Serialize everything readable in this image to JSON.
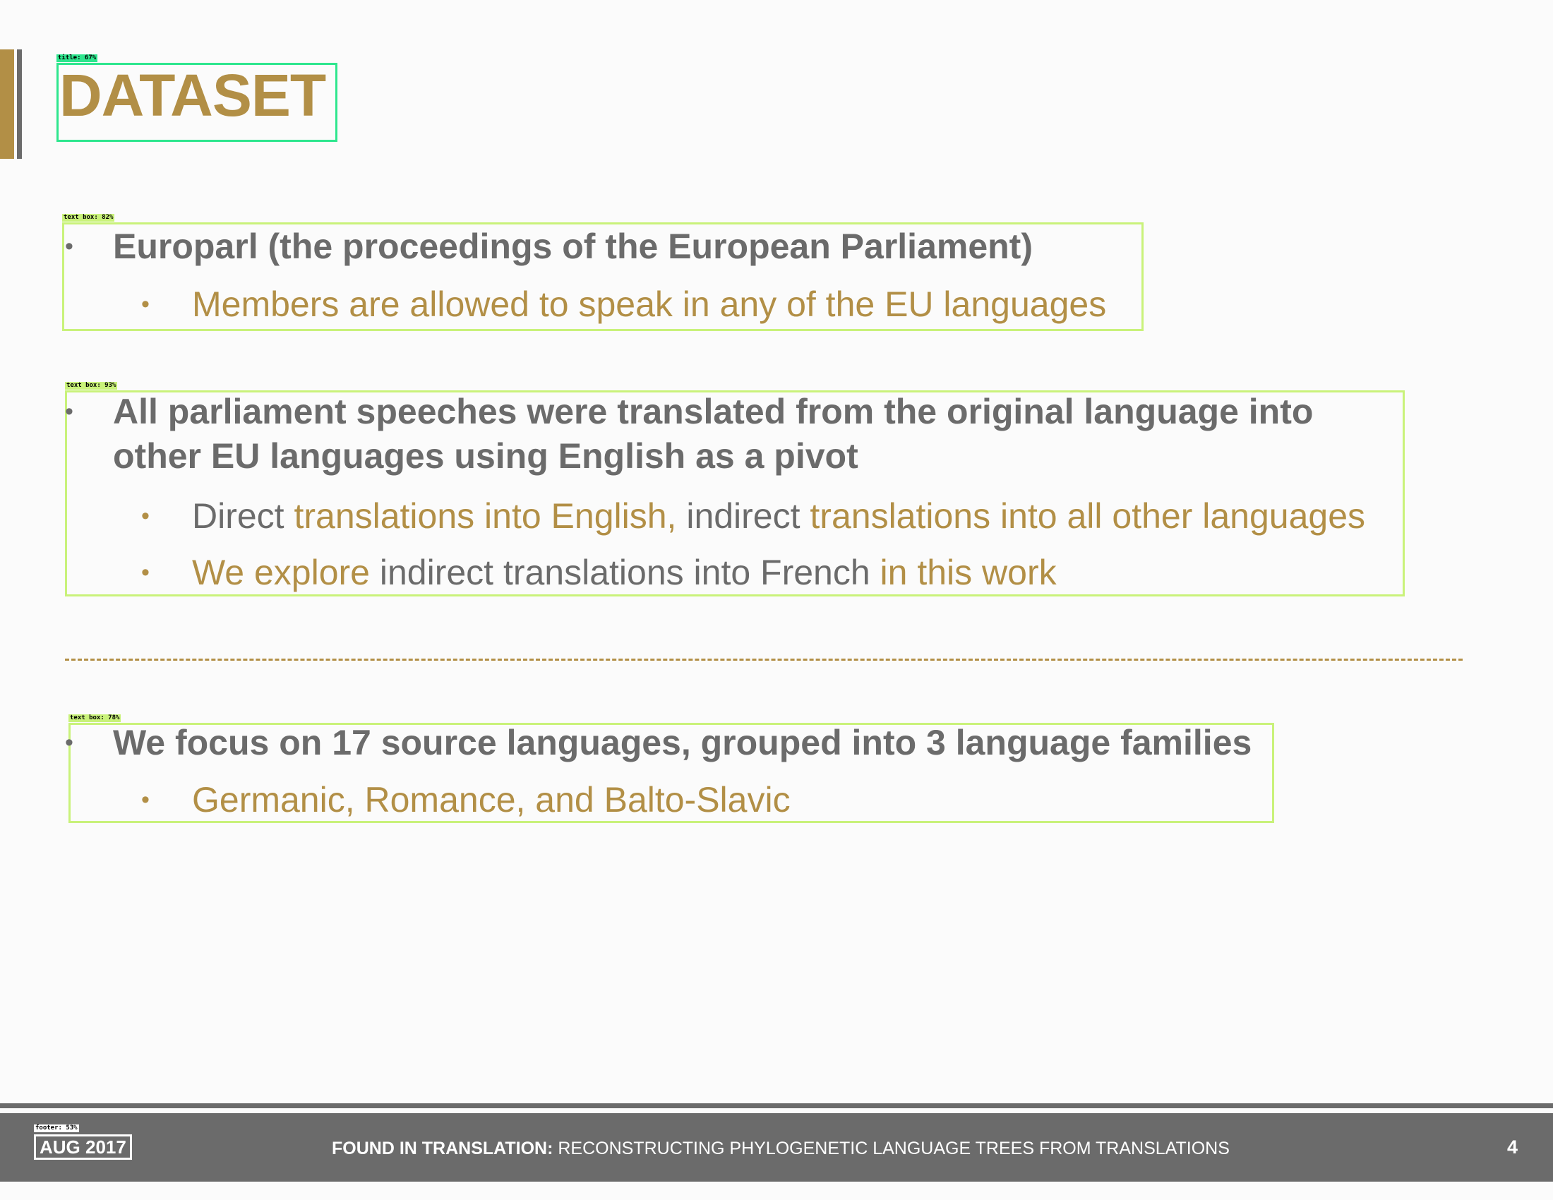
{
  "title": "DATASET",
  "annotations": {
    "title": "title: 67%",
    "text_box_1": "text box: 82%",
    "text_box_2": "text box: 93%",
    "text_box_3": "text box: 78%",
    "footer": "footer: 53%"
  },
  "blocks": [
    {
      "main": "Europarl (the proceedings of the European Parliament)",
      "sub": [
        {
          "segments": [
            {
              "text": "Members are allowed to speak in any of the EU languages",
              "color": "gold"
            }
          ]
        }
      ]
    },
    {
      "main_line1": "All parliament speeches were translated from the original language into",
      "main_line2": "other EU languages using English as a pivot",
      "sub": [
        {
          "segments": [
            {
              "text": "Direct ",
              "color": "gray"
            },
            {
              "text": "translations into English,",
              "color": "gold"
            },
            {
              "text": " indirect ",
              "color": "gray"
            },
            {
              "text": "translations into all other languages",
              "color": "gold"
            }
          ]
        },
        {
          "segments": [
            {
              "text": "We explore ",
              "color": "gold"
            },
            {
              "text": "indirect translations into French ",
              "color": "gray"
            },
            {
              "text": "in this work",
              "color": "gold"
            }
          ]
        }
      ]
    },
    {
      "main": "We focus on 17 source languages, grouped into 3 language families",
      "sub": [
        {
          "segments": [
            {
              "text": "Germanic, Romance, and Balto-Slavic",
              "color": "gold"
            }
          ]
        }
      ]
    }
  ],
  "footer": {
    "date": "AUG 2017",
    "title_bold": "FOUND IN TRANSLATION:",
    "title_rest": " RECONSTRUCTING PHYLOGENETIC LANGUAGE TREES FROM TRANSLATIONS",
    "page_number": "4"
  },
  "colors": {
    "accent_gold": "#b28f46",
    "text_gray": "#6b6b6b",
    "footer_bg": "#6b6b6b",
    "annotation_text_box": "#c9f27a",
    "annotation_title": "#2ee68e"
  }
}
